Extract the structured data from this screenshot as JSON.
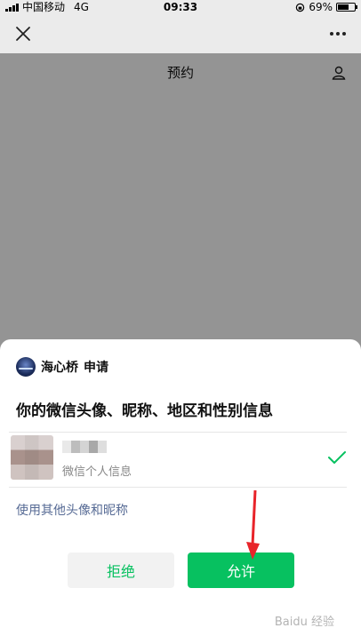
{
  "status_bar": {
    "carrier": "中国移动",
    "network": "4G",
    "time": "09:33",
    "battery": "69%",
    "battery_level": 0.69
  },
  "page": {
    "title": "预约"
  },
  "sheet": {
    "app_name": "海心桥",
    "request_label": "申请",
    "permission_text": "你的微信头像、昵称、地区和性别信息",
    "profile_subtitle": "微信个人信息",
    "other_link": "使用其他头像和昵称",
    "reject_label": "拒绝",
    "allow_label": "允许"
  },
  "colors": {
    "accent_green": "#07c160",
    "link_blue": "#576b95",
    "annotation_red": "#e8242a"
  },
  "icons": [
    "close-icon",
    "more-icon",
    "user-icon",
    "app-logo",
    "check-icon",
    "battery-icon",
    "signal-icon"
  ],
  "watermark": "Baidu 经验"
}
